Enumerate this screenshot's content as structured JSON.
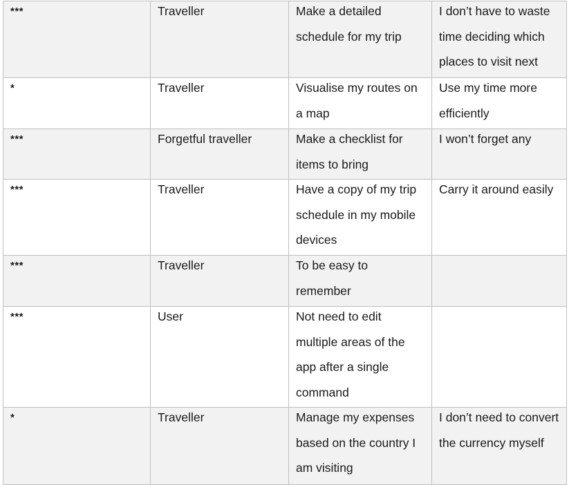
{
  "rows": [
    {
      "priority": "***",
      "as_a": "Traveller",
      "i_want_to": "Make a detailed schedule for my trip",
      "so_that": "I don’t have to waste time deciding which places to visit next"
    },
    {
      "priority": "*",
      "as_a": "Traveller",
      "i_want_to": "Visualise my routes on a map",
      "so_that": "Use my time more efficiently"
    },
    {
      "priority": "***",
      "as_a": "Forgetful traveller",
      "i_want_to": "Make a checklist for items to bring",
      "so_that": "I won’t forget any"
    },
    {
      "priority": "***",
      "as_a": "Traveller",
      "i_want_to": "Have a copy of my trip schedule in my mobile devices",
      "so_that": "Carry it around easily"
    },
    {
      "priority": "***",
      "as_a": "Traveller",
      "i_want_to": "To be easy to remember",
      "so_that": ""
    },
    {
      "priority": "***",
      "as_a": "User",
      "i_want_to": "Not need to edit multiple areas of the app after a single command",
      "so_that": ""
    },
    {
      "priority": "*",
      "as_a": "Traveller",
      "i_want_to": "Manage my expenses based on the country I am visiting",
      "so_that": "I don’t need to convert the currency myself"
    }
  ]
}
